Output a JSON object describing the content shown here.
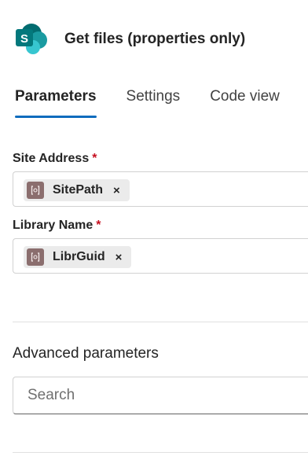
{
  "header": {
    "title": "Get files (properties only)",
    "icon": "sharepoint-icon",
    "icon_letter": "S",
    "brand_colors": {
      "dark": "#036c70",
      "mid": "#1a9ba1",
      "light": "#37c6d0"
    }
  },
  "tabs": [
    {
      "label": "Parameters",
      "active": true
    },
    {
      "label": "Settings",
      "active": false
    },
    {
      "label": "Code view",
      "active": false
    }
  ],
  "fields": [
    {
      "label": "Site Address",
      "required_mark": "*",
      "token": {
        "label": "SitePath",
        "icon": "expression-icon",
        "remove": "×"
      }
    },
    {
      "label": "Library Name",
      "required_mark": "*",
      "token": {
        "label": "LibrGuid",
        "icon": "expression-icon",
        "remove": "×"
      }
    }
  ],
  "advanced": {
    "heading": "Advanced parameters",
    "search_placeholder": "Search",
    "search_value": ""
  },
  "colors": {
    "accent": "#0f6cbd",
    "required": "#c50f1f",
    "token_icon_bg": "#8b6e6e",
    "token_bg": "#ebebeb"
  }
}
